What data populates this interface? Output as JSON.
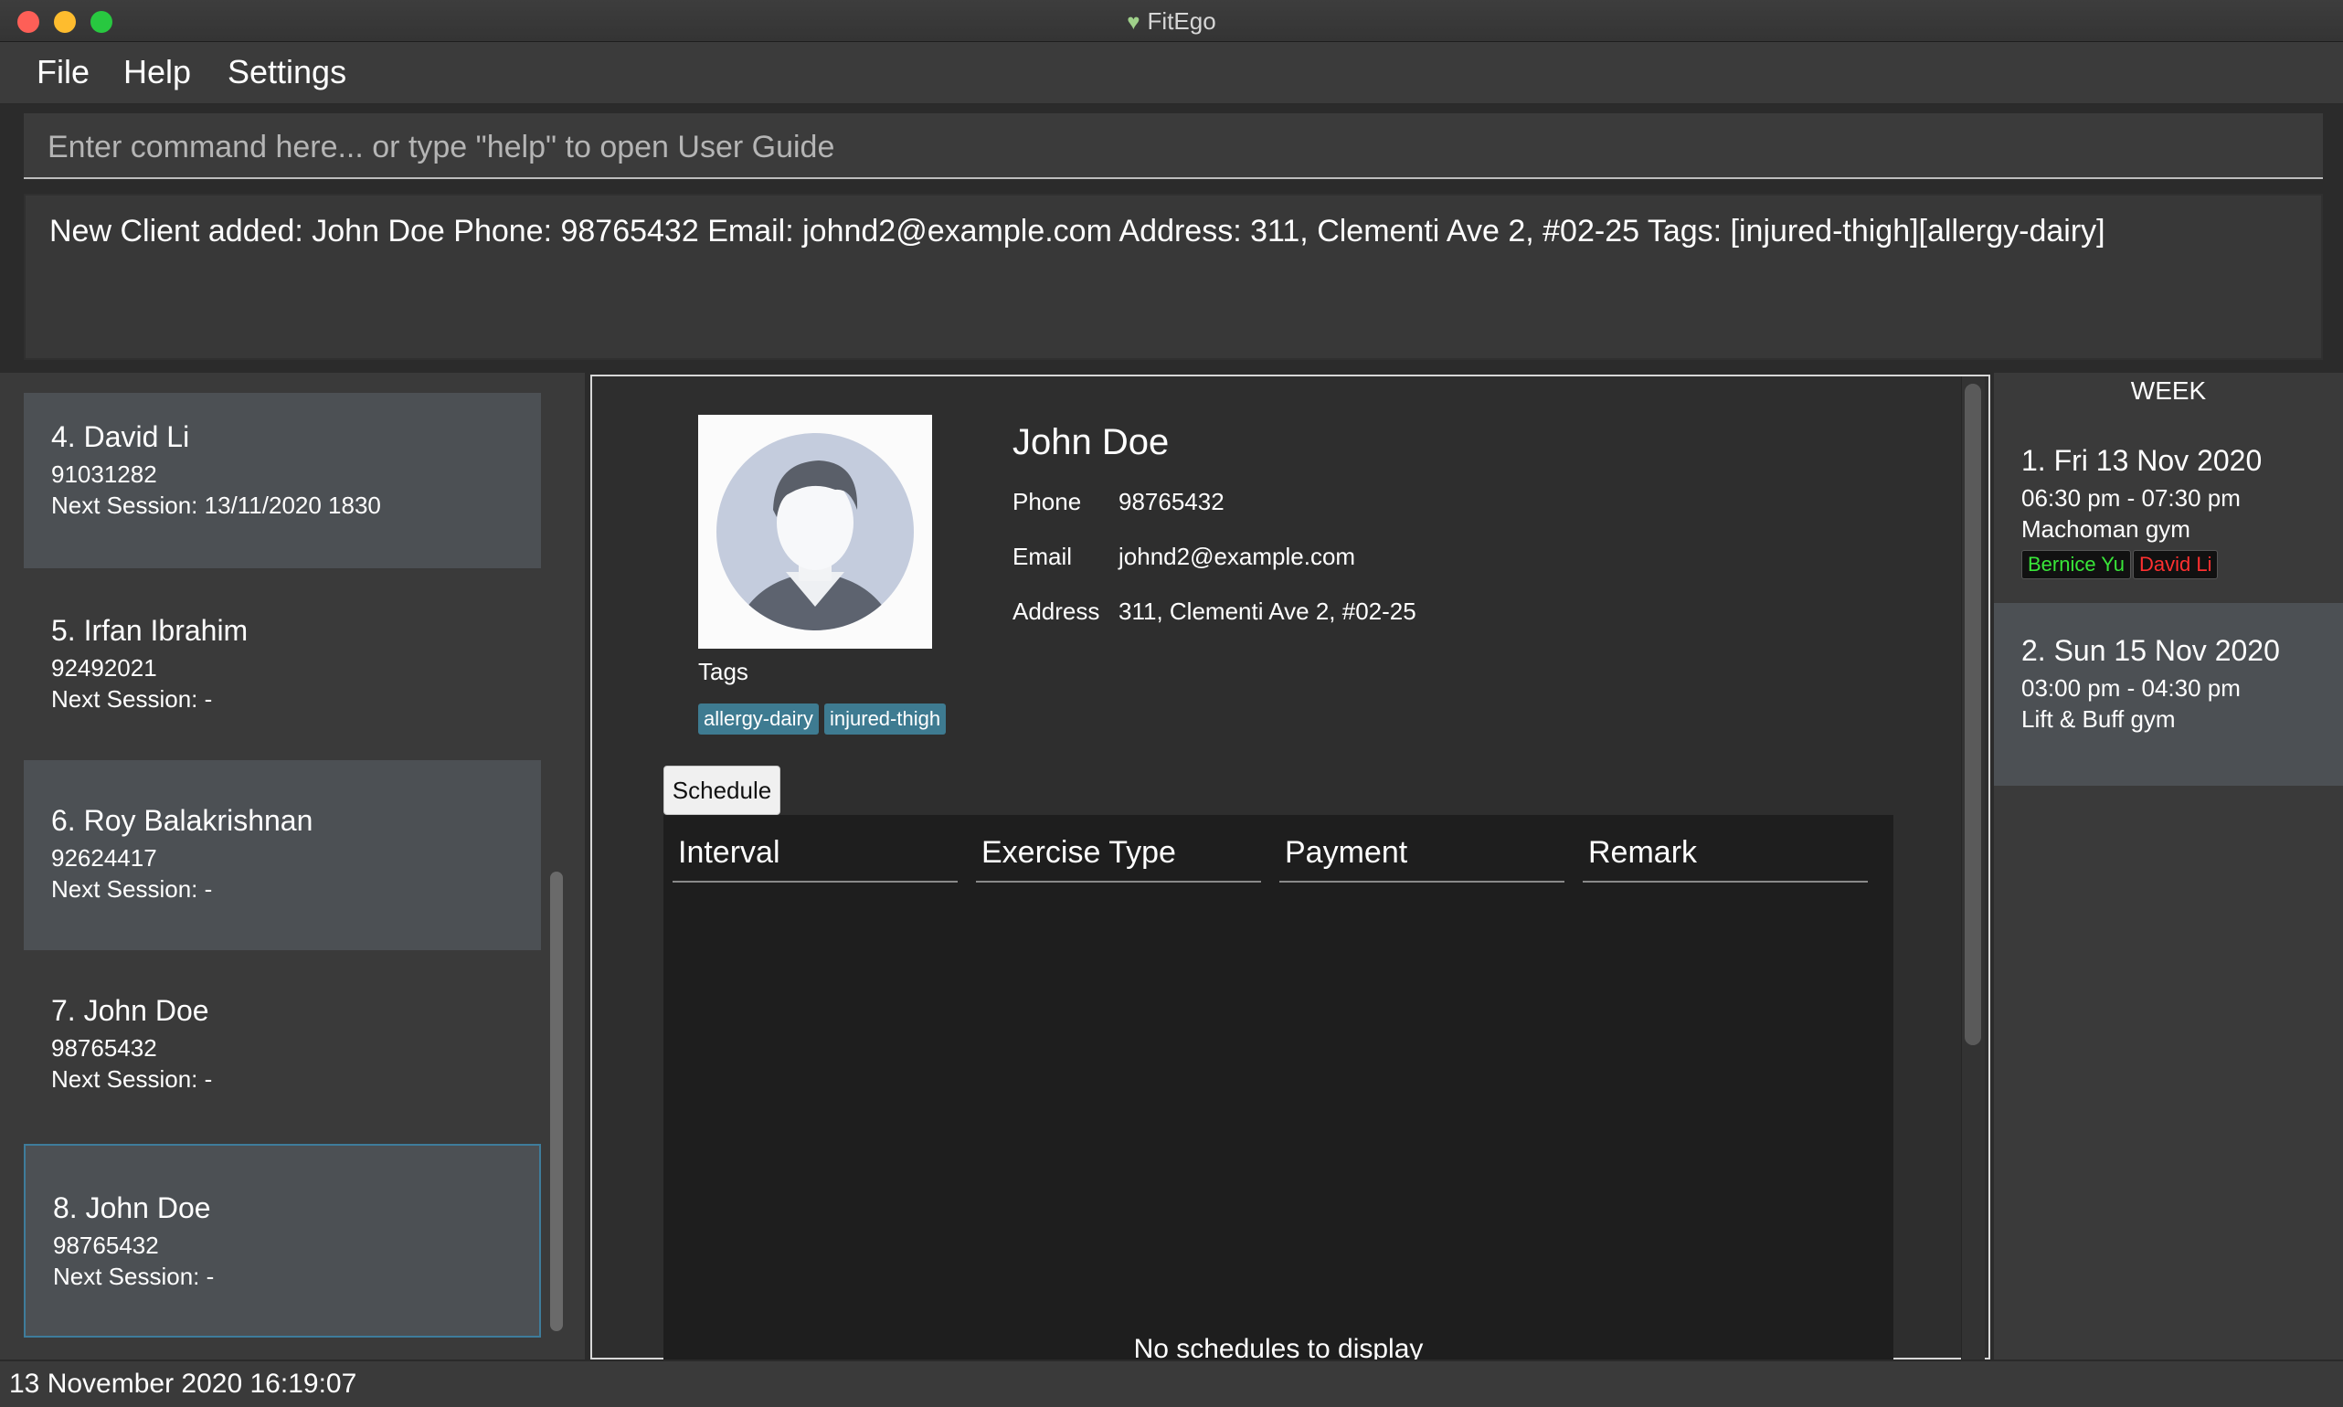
{
  "window": {
    "title": "FitEgo"
  },
  "menu": {
    "file": "File",
    "help": "Help",
    "settings": "Settings"
  },
  "command": {
    "placeholder": "Enter command here... or type \"help\" to open User Guide",
    "value": ""
  },
  "result": {
    "text": "New Client added: John Doe Phone: 98765432 Email: johnd2@example.com Address: 311, Clementi Ave 2, #02-25 Tags: [injured-thigh][allergy-dairy]"
  },
  "clients": [
    {
      "name": "4.  David Li",
      "phone": "91031282",
      "next": "Next Session: 13/11/2020 1830"
    },
    {
      "name": "5.  Irfan Ibrahim",
      "phone": "92492021",
      "next": "Next Session:  -"
    },
    {
      "name": "6.  Roy Balakrishnan",
      "phone": "92624417",
      "next": "Next Session:  -"
    },
    {
      "name": "7.  John Doe",
      "phone": "98765432",
      "next": "Next Session:  -"
    },
    {
      "name": "8.  John Doe",
      "phone": "98765432",
      "next": "Next Session:  -"
    }
  ],
  "profile": {
    "name": "John Doe",
    "phone_label": "Phone",
    "phone": "98765432",
    "email_label": "Email",
    "email": "johnd2@example.com",
    "address_label": "Address",
    "address": "311, Clementi Ave 2, #02-25",
    "tags_label": "Tags",
    "tags": [
      "allergy-dairy",
      "injured-thigh"
    ],
    "schedule_button": "Schedule",
    "columns": [
      "Interval",
      "Exercise Type",
      "Payment",
      "Remark"
    ],
    "empty_message": "No schedules to display"
  },
  "week": {
    "header": "WEEK",
    "sessions": [
      {
        "date": "1.  Fri 13 Nov 2020",
        "time": "06:30 pm - 07:30 pm",
        "location": "Machoman gym",
        "chips": [
          {
            "label": "Bernice Yu",
            "color": "#39e639"
          },
          {
            "label": "David Li",
            "color": "#ff3030"
          }
        ]
      },
      {
        "date": "2.  Sun 15 Nov 2020",
        "time": "03:00 pm - 04:30 pm",
        "location": "Lift & Buff gym",
        "chips": []
      }
    ]
  },
  "status": {
    "datetime": "13 November 2020 16:19:07"
  }
}
